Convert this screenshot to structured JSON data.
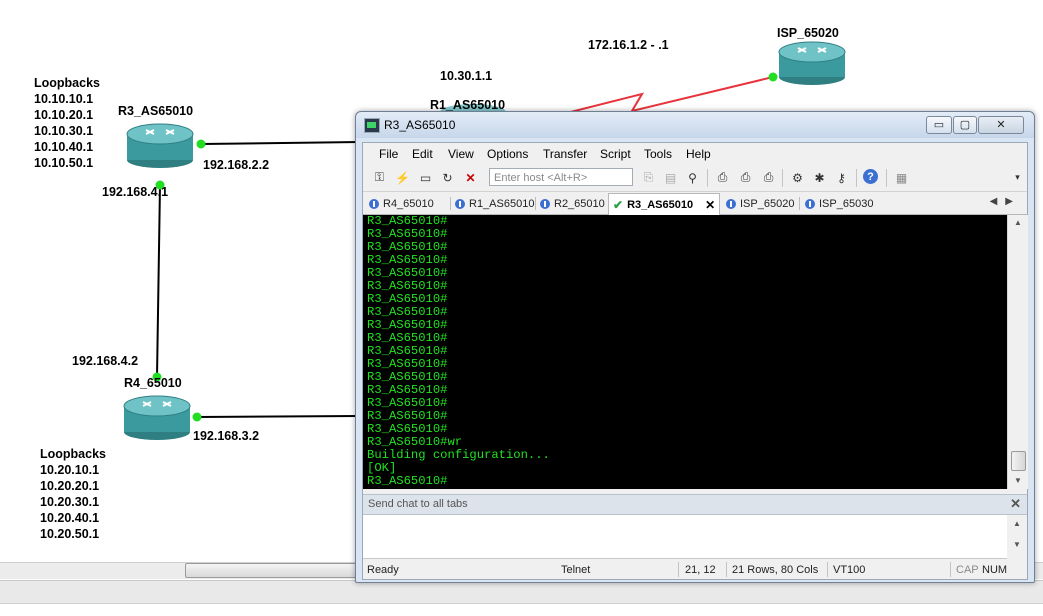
{
  "topology": {
    "routers": {
      "r3": "R3_AS65010",
      "r1": "R1_AS65010",
      "r4": "R4_65010",
      "isp": "ISP_65020"
    },
    "links": {
      "r3_r1_ip": "192.168.2.2",
      "r3_r4_top_ip": "192.168.4.1",
      "r3_r4_bottom_ip": "192.168.4.2",
      "r4_ip": "192.168.3.2",
      "r1_net": "10.30.1.1",
      "isp_link": "172.16.1.2 - .1"
    },
    "loopbacks_r3": {
      "title": "Loopbacks",
      "items": [
        "10.10.10.1",
        "10.10.20.1",
        "10.10.30.1",
        "10.10.40.1",
        "10.10.50.1"
      ]
    },
    "loopbacks_r4": {
      "title": "Loopbacks",
      "items": [
        "10.20.10.1",
        "10.20.20.1",
        "10.20.30.1",
        "10.20.40.1",
        "10.20.50.1"
      ]
    },
    "link_colors": {
      "normal": "#000000",
      "serial": "#e8323c",
      "port_up": "#22dd22"
    }
  },
  "window": {
    "title": "R3_AS65010",
    "buttons": {
      "min": "▭",
      "max": "▢",
      "close": "✕"
    }
  },
  "menu": [
    "File",
    "Edit",
    "View",
    "Options",
    "Transfer",
    "Script",
    "Tools",
    "Help"
  ],
  "toolbar": {
    "host_placeholder": "Enter host <Alt+R>"
  },
  "tabs": [
    {
      "label": "R4_65010",
      "active": false
    },
    {
      "label": "R1_AS65010",
      "active": false
    },
    {
      "label": "R2_65010",
      "active": false
    },
    {
      "label": "R3_AS65010",
      "active": true
    },
    {
      "label": "ISP_65020",
      "active": false
    },
    {
      "label": "ISP_65030",
      "active": false
    }
  ],
  "terminal": {
    "lines": [
      "R3_AS65010#",
      "R3_AS65010#",
      "R3_AS65010#",
      "R3_AS65010#",
      "R3_AS65010#",
      "R3_AS65010#",
      "R3_AS65010#",
      "R3_AS65010#",
      "R3_AS65010#",
      "R3_AS65010#",
      "R3_AS65010#",
      "R3_AS65010#",
      "R3_AS65010#",
      "R3_AS65010#",
      "R3_AS65010#",
      "R3_AS65010#",
      "R3_AS65010#",
      "R3_AS65010#wr",
      "Building configuration...",
      "[OK]",
      "R3_AS65010#"
    ],
    "text_color": "#22e022",
    "bg_color": "#000000"
  },
  "chat": {
    "label": "Send chat to all tabs"
  },
  "status": {
    "ready": "Ready",
    "protocol": "Telnet",
    "cursor": "21, 12",
    "size": "21 Rows, 80 Cols",
    "emulation": "VT100",
    "cap": "CAP",
    "num": "NUM"
  }
}
